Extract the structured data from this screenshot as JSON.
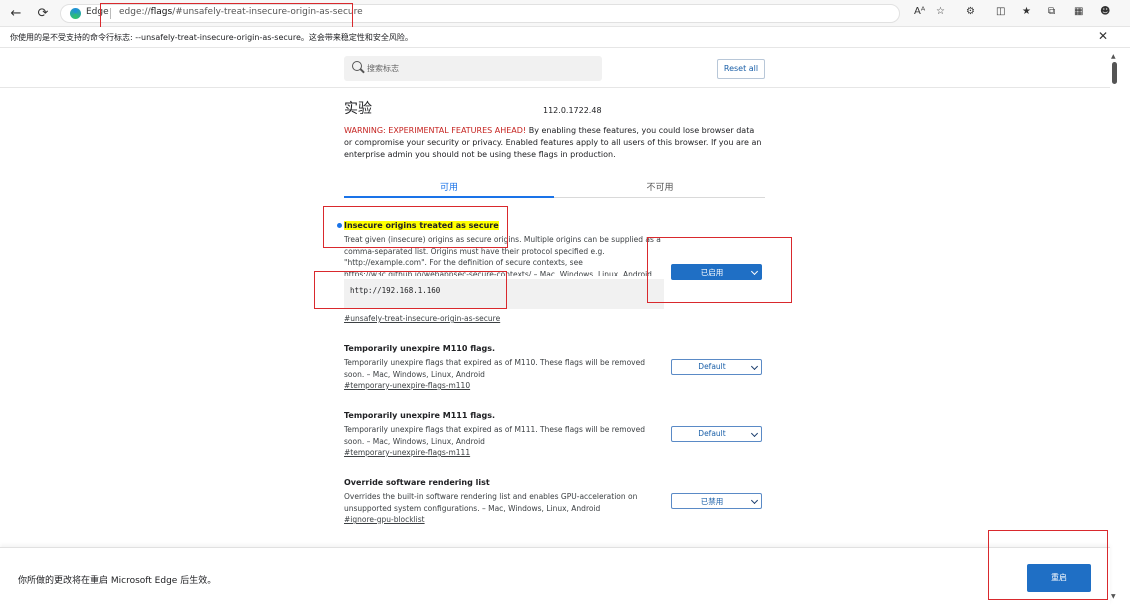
{
  "browser": {
    "brand": "Edge",
    "url_prefix": "edge://",
    "url_bold": "flags",
    "url_rest": "/#unsafely-treat-insecure-origin-as-secure",
    "read_aloud_label": "Aᴬ"
  },
  "infobar": {
    "message": "你使用的是不受支持的命令行标志: --unsafely-treat-insecure-origin-as-secure。这会带来稳定性和安全风险。"
  },
  "header": {
    "search_placeholder": "搜索标志",
    "reset_label": "Reset all"
  },
  "main": {
    "title": "实验",
    "version": "112.0.1722.48",
    "warning_red": "WARNING: EXPERIMENTAL FEATURES AHEAD!",
    "warning_text": " By enabling these features, you could lose browser data or compromise your security or privacy. Enabled features apply to all users of this browser. If you are an enterprise admin you should not be using these flags in production.",
    "tabs": [
      {
        "label": "可用"
      },
      {
        "label": "不可用"
      }
    ]
  },
  "flags": [
    {
      "title": "Insecure origins treated as secure",
      "description": "Treat given (insecure) origins as secure origins. Multiple origins can be supplied as a comma-separated list. Origins must have their protocol specified e.g. \"http://example.com\". For the definition of secure contexts, see https://w3c.github.io/webappsec-secure-contexts/ – Mac, Windows, Linux, Android",
      "textarea_value": "http://192.168.1.160",
      "link": "#unsafely-treat-insecure-origin-as-secure",
      "select_value": "已启用"
    },
    {
      "title": "Temporarily unexpire M110 flags.",
      "description": "Temporarily unexpire flags that expired as of M110. These flags will be removed soon. – Mac, Windows, Linux, Android",
      "link": "#temporary-unexpire-flags-m110",
      "select_value": "Default"
    },
    {
      "title": "Temporarily unexpire M111 flags.",
      "description": "Temporarily unexpire flags that expired as of M111. These flags will be removed soon. – Mac, Windows, Linux, Android",
      "link": "#temporary-unexpire-flags-m111",
      "select_value": "Default"
    },
    {
      "title": "Override software rendering list",
      "description": "Overrides the built-in software rendering list and enables GPU-acceleration on unsupported system configurations. – Mac, Windows, Linux, Android",
      "link": "#ignore-gpu-blocklist",
      "select_value": "已禁用"
    }
  ],
  "bottom": {
    "message": "你所做的更改将在重启 Microsoft Edge 后生效。",
    "relaunch_label": "重启"
  },
  "colors": {
    "accent": "#1a73e8",
    "button_blue": "#1f6fc5",
    "warning_red": "#c5221f",
    "annotation_red": "#d9292d",
    "highlight": "#ffff00"
  }
}
